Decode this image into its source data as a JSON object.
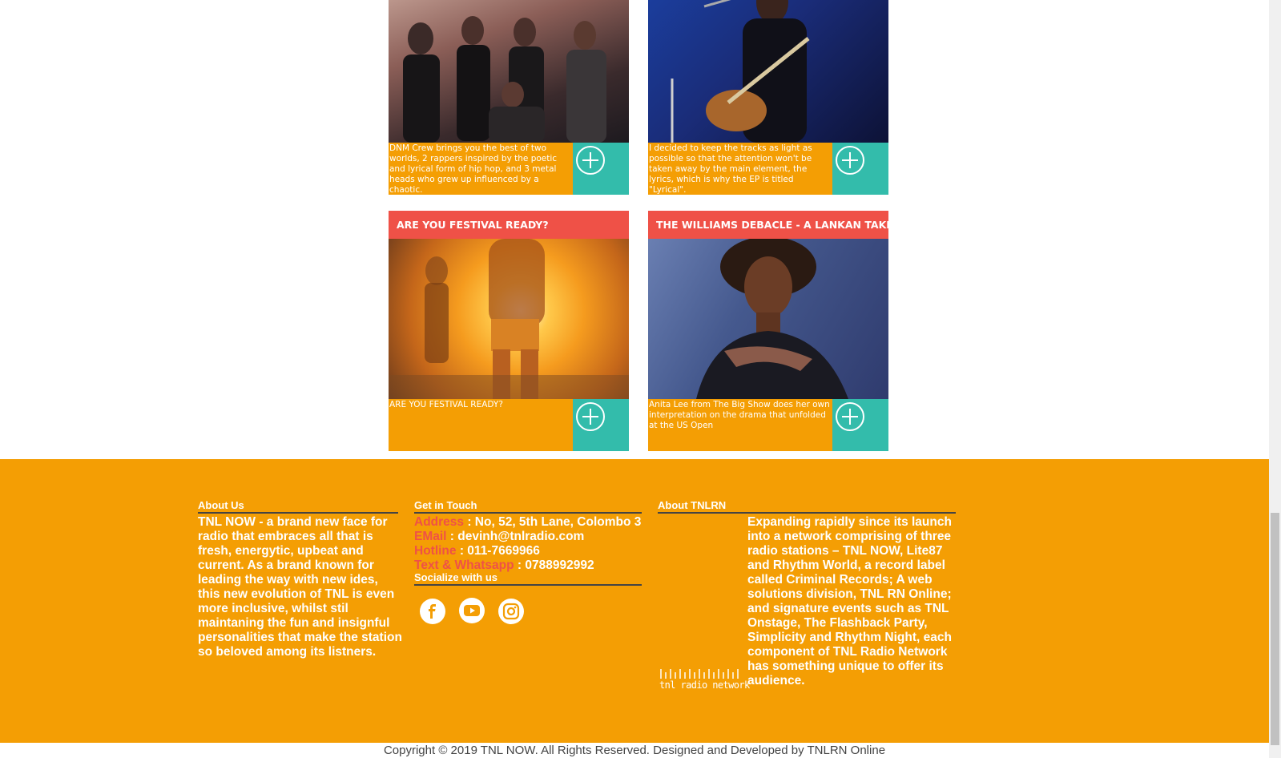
{
  "cards": [
    {
      "title": "",
      "description": "DNM Crew brings you the best of two worlds, 2 rappers inspired by the poetic and lyrical form of hip hop, and 3 metal heads who grew up influenced by a chaotic."
    },
    {
      "title": "",
      "description": "I decided to keep the tracks as light as possible so that the attention won't be taken away by the main element, the lyrics, which is why the EP is titled \"Lyrical\"."
    },
    {
      "title": "ARE YOU FESTIVAL READY?",
      "description": "ARE YOU FESTIVAL READY?"
    },
    {
      "title": "THE WILLIAMS DEBACLE - A LANKAN TAKE",
      "description": "Anita Lee from The Big Show does her own interpretation on the drama that unfolded at the US Open"
    }
  ],
  "footer": {
    "about_us": {
      "heading": "About Us",
      "text": "TNL NOW - a brand new face for radio that embraces all that is fresh, energytic, upbeat and current. As a brand known for leading the way with new ides, this new evolution of TNL is even more inclusive, whilst stil maintaning the fun and insignful personalities that make the station so beloved among its listners."
    },
    "contact": {
      "heading": "Get in Touch",
      "address_label": "Address",
      "address_value": " : No, 52, 5th Lane, Colombo 3",
      "email_label": "EMail",
      "email_value": " : devinh@tnlradio.com",
      "hotline_label": "Hotline",
      "hotline_value": " : 011-7669966",
      "whatsapp_label": "Text & Whatsapp",
      "whatsapp_value": " : 0788992992",
      "social_heading": "Socialize with us"
    },
    "about_tnlrn": {
      "heading": "About TNLRN",
      "logo_text": "tnl radio network",
      "text": "Expanding rapidly since its launch into a network comprising of three radio stations – TNL NOW, Lite87 and Rhythm World, a record label called Criminal Records; A web solutions division, TNL RN Online; and signature events such as TNL Onstage, The Flashback Party, Simplicity and Rhythm Night, each component of TNL Radio Network has something unique to offer its audience."
    },
    "copyright": "Copyright © 2019 TNL NOW. All Rights Reserved. Designed and Developed by TNLRN Online"
  },
  "social_icons": [
    "facebook-icon",
    "youtube-icon",
    "instagram-icon"
  ],
  "colors": {
    "orange": "#f49e04",
    "teal": "#33bcab",
    "red": "#ef5147"
  }
}
